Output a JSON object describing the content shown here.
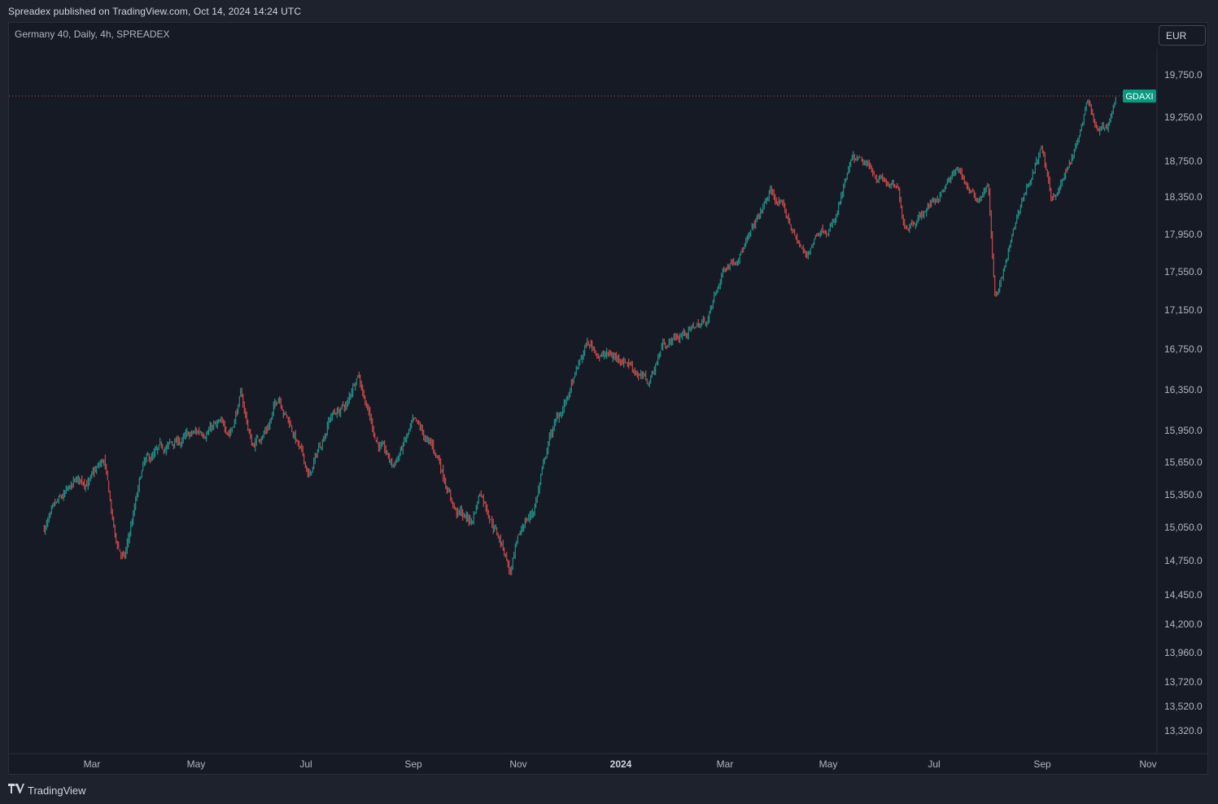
{
  "header": {
    "publisher": "Spreadex published on TradingView.com, Oct 14, 2024 14:24 UTC"
  },
  "symbol": {
    "description": "Germany 40, Daily, 4h, SPREADEX",
    "ticker": "GDAXI"
  },
  "currency": {
    "label": "EUR"
  },
  "footer": {
    "brand": "TradingView"
  },
  "colors": {
    "up": "#26a69a",
    "down": "#ef5350",
    "background": "#161a25",
    "last_price_line": "#ef5350",
    "ticker_badge": "#089981"
  },
  "chart_data": {
    "type": "candlestick",
    "title": "Germany 40, Daily, 4h, SPREADEX",
    "ticker": "GDAXI",
    "currency": "EUR",
    "y_axis_ticks": [
      "19,750.0",
      "19,250.0",
      "18,750.0",
      "18,350.0",
      "17,950.0",
      "17,550.0",
      "17,150.0",
      "16,750.0",
      "16,350.0",
      "15,950.0",
      "15,650.0",
      "15,350.0",
      "15,050.0",
      "14,750.0",
      "14,450.0",
      "14,200.0",
      "13,960.0",
      "13,720.0",
      "13,520.0",
      "13,320.0"
    ],
    "x_axis_ticks": [
      "Mar",
      "May",
      "Jul",
      "Sep",
      "Nov",
      "2024",
      "Mar",
      "May",
      "Jul",
      "Sep",
      "Nov"
    ],
    "last_price": 19500,
    "price_path": [
      [
        "2023-02-01",
        15050
      ],
      [
        "2023-02-10",
        15250
      ],
      [
        "2023-02-20",
        15450
      ],
      [
        "2023-03-01",
        15500
      ],
      [
        "2023-03-08",
        15650
      ],
      [
        "2023-03-15",
        14900
      ],
      [
        "2023-03-20",
        14750
      ],
      [
        "2023-03-31",
        15600
      ],
      [
        "2023-04-15",
        15800
      ],
      [
        "2023-04-30",
        15900
      ],
      [
        "2023-05-10",
        16000
      ],
      [
        "2023-05-20",
        15950
      ],
      [
        "2023-05-26",
        16300
      ],
      [
        "2023-06-01",
        15800
      ],
      [
        "2023-06-10",
        16000
      ],
      [
        "2023-06-16",
        16300
      ],
      [
        "2023-06-25",
        15900
      ],
      [
        "2023-07-03",
        15500
      ],
      [
        "2023-07-15",
        16100
      ],
      [
        "2023-07-25",
        16200
      ],
      [
        "2023-07-31",
        16550
      ],
      [
        "2023-08-10",
        15900
      ],
      [
        "2023-08-20",
        15600
      ],
      [
        "2023-09-01",
        16000
      ],
      [
        "2023-09-15",
        15700
      ],
      [
        "2023-09-26",
        15200
      ],
      [
        "2023-10-05",
        15100
      ],
      [
        "2023-10-10",
        15400
      ],
      [
        "2023-10-25",
        14800
      ],
      [
        "2023-10-27",
        14650
      ],
      [
        "2023-11-05",
        15100
      ],
      [
        "2023-11-10",
        15200
      ],
      [
        "2023-11-20",
        15900
      ],
      [
        "2023-12-01",
        16300
      ],
      [
        "2023-12-12",
        16800
      ],
      [
        "2023-12-20",
        16700
      ],
      [
        "2024-01-05",
        16650
      ],
      [
        "2024-01-17",
        16400
      ],
      [
        "2024-01-25",
        16800
      ],
      [
        "2024-02-05",
        16900
      ],
      [
        "2024-02-20",
        17050
      ],
      [
        "2024-03-01",
        17600
      ],
      [
        "2024-03-15",
        17900
      ],
      [
        "2024-03-28",
        18400
      ],
      [
        "2024-04-05",
        18200
      ],
      [
        "2024-04-12",
        17900
      ],
      [
        "2024-04-18",
        17700
      ],
      [
        "2024-04-25",
        18000
      ],
      [
        "2024-05-05",
        18100
      ],
      [
        "2024-05-15",
        18750
      ],
      [
        "2024-05-20",
        18700
      ],
      [
        "2024-06-01",
        18550
      ],
      [
        "2024-06-10",
        18400
      ],
      [
        "2024-06-14",
        18050
      ],
      [
        "2024-06-25",
        18200
      ],
      [
        "2024-07-05",
        18400
      ],
      [
        "2024-07-15",
        18650
      ],
      [
        "2024-07-25",
        18300
      ],
      [
        "2024-08-01",
        18500
      ],
      [
        "2024-08-05",
        17250
      ],
      [
        "2024-08-08",
        17400
      ],
      [
        "2024-08-20",
        18300
      ],
      [
        "2024-09-01",
        18900
      ],
      [
        "2024-09-06",
        18300
      ],
      [
        "2024-09-12",
        18500
      ],
      [
        "2024-09-20",
        18850
      ],
      [
        "2024-09-27",
        19400
      ],
      [
        "2024-10-03",
        19050
      ],
      [
        "2024-10-08",
        19100
      ],
      [
        "2024-10-14",
        19500
      ]
    ]
  }
}
